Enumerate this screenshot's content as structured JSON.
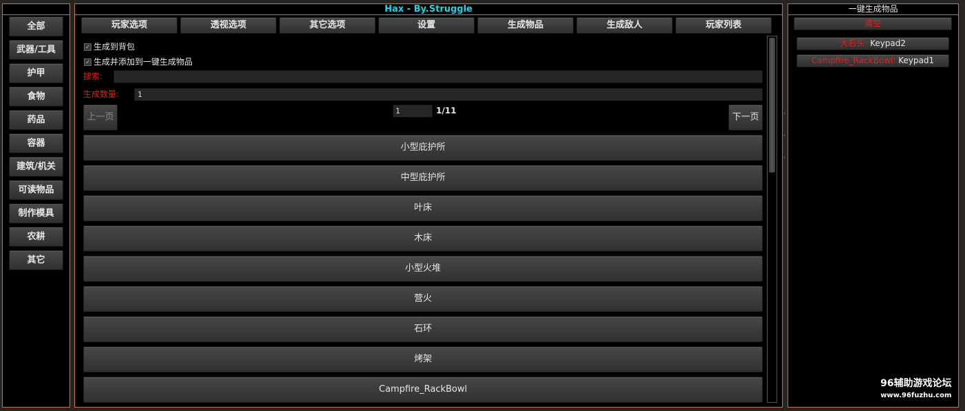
{
  "left_panel": {
    "categories": [
      "全部",
      "武器/工具",
      "护甲",
      "食物",
      "药品",
      "容器",
      "建筑/机关",
      "可读物品",
      "制作模具",
      "农耕",
      "其它"
    ]
  },
  "main_panel": {
    "title": "Hax - By.Struggle",
    "title_color": "#1fd6e6",
    "tabs": [
      "玩家选项",
      "透视选项",
      "其它选项",
      "设置",
      "生成物品",
      "生成敌人",
      "玩家列表"
    ],
    "options": {
      "spawn_to_bag": "生成到背包",
      "spawn_and_add": "生成并添加到一键生成物品"
    },
    "search": {
      "label": "搜索:",
      "value": ""
    },
    "quantity": {
      "label": "生成数量:",
      "value": "1"
    },
    "pagination": {
      "prev": "上一页",
      "next": "下一页",
      "current": "1",
      "total": "1/11"
    },
    "items": [
      "小型庇护所",
      "中型庇护所",
      "叶床",
      "木床",
      "小型火堆",
      "营火",
      "石环",
      "烤架",
      "Campfire_RackBowl"
    ]
  },
  "right_panel": {
    "title": "一键生成物品",
    "clear_label": "清空",
    "quick_items": [
      {
        "name": "大石头:",
        "key": "Keypad2"
      },
      {
        "name": "Campfire_RackBowl:",
        "key": "Keypad1"
      }
    ]
  },
  "watermark": {
    "title": "96辅助游戏论坛",
    "url": "www.96fuzhu.com"
  },
  "accent_color": "#c8704a",
  "label_color": "#e0201a"
}
